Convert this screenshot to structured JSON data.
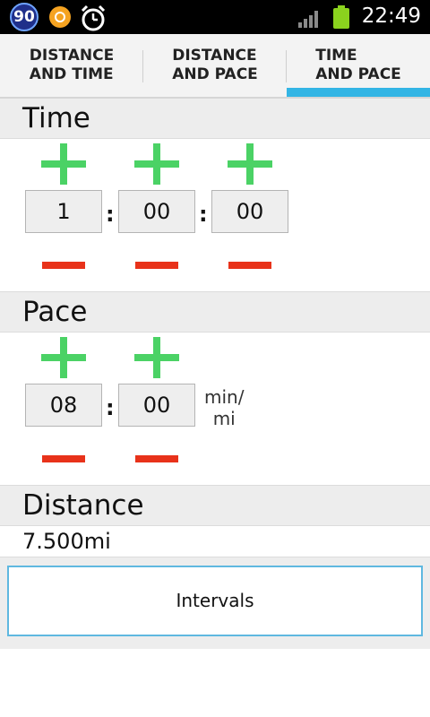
{
  "status_bar": {
    "badge_number": "90",
    "time": "22:49",
    "icons": [
      "badge-90-icon",
      "orange-app-icon",
      "alarm-clock-icon",
      "signal-icon",
      "battery-icon"
    ],
    "battery_color": "#8bd21e"
  },
  "tabs": [
    {
      "label": "DISTANCE\nAND TIME",
      "selected": false
    },
    {
      "label": "DISTANCE\nAND PACE",
      "selected": false
    },
    {
      "label": "TIME\nAND PACE",
      "selected": true
    }
  ],
  "colors": {
    "accent": "#33b5e5",
    "plus": "#4bd265",
    "minus": "#e8321a"
  },
  "time_section": {
    "title": "Time",
    "hours": "1",
    "minutes": "00",
    "seconds": "00",
    "separator": ":"
  },
  "pace_section": {
    "title": "Pace",
    "minutes": "08",
    "seconds": "00",
    "separator": ":",
    "unit": "min/\nmi"
  },
  "distance_section": {
    "title": "Distance",
    "value": "7.500mi"
  },
  "intervals_button": {
    "label": "Intervals"
  }
}
